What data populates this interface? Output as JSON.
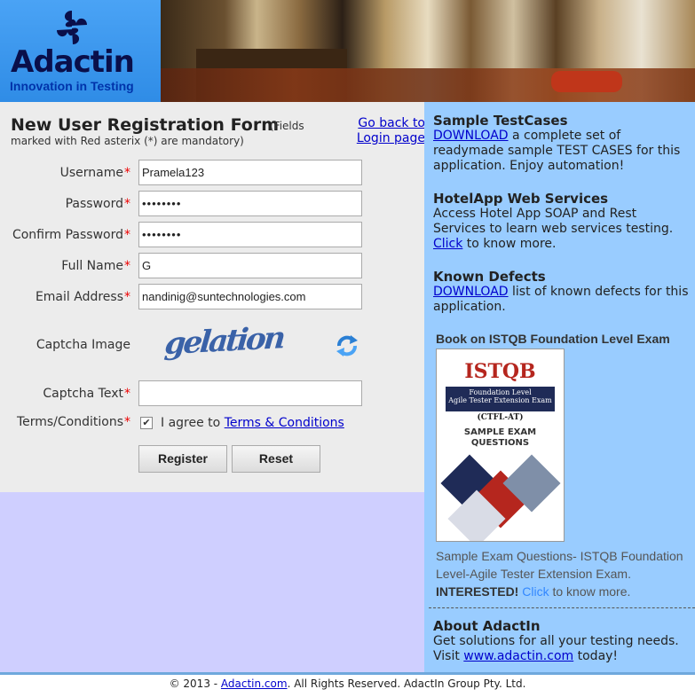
{
  "header": {
    "logo_text": "Adactin",
    "logo_tagline": "Innovation in Testing"
  },
  "form": {
    "title": "New User Registration Form",
    "note_part1": "(Fields",
    "note_part2": "marked with Red asterix (*) are mandatory)",
    "back_link_line1": "Go back to",
    "back_link_line2": "Login page",
    "required_marker": "*",
    "fields": {
      "username": {
        "label": "Username",
        "value": "Pramela123"
      },
      "password": {
        "label": "Password",
        "value": "••••••••"
      },
      "confirm_password": {
        "label": "Confirm Password",
        "value": "••••••••"
      },
      "full_name": {
        "label": "Full Name",
        "value": "G"
      },
      "email": {
        "label": "Email Address",
        "value": "nandinig@suntechnologies.com"
      },
      "captcha_image": {
        "label": "Captcha Image",
        "value": "gelation"
      },
      "captcha_text": {
        "label": "Captcha Text",
        "value": ""
      },
      "terms": {
        "label": "Terms/Conditions",
        "checked": true,
        "check_glyph": "✔",
        "agree_text": "I agree to",
        "link_text": "Terms & Conditions"
      }
    },
    "buttons": {
      "register": "Register",
      "reset": "Reset"
    }
  },
  "sidebar": {
    "sample_testcases": {
      "title": "Sample TestCases",
      "link": "DOWNLOAD",
      "text": " a complete set of readymade sample TEST CASES for this application. Enjoy automation!"
    },
    "web_services": {
      "title": "HotelApp Web Services",
      "text": "Access Hotel App SOAP and Rest Services to learn web services testing.",
      "link": "Click",
      "text_after": " to know more."
    },
    "known_defects": {
      "title": "Known Defects",
      "link": "DOWNLOAD",
      "text": " list of known defects for this application."
    },
    "book": {
      "title": "Book on ISTQB Foundation Level Exam",
      "cover_title": "ISTQB",
      "cover_band_line1": "Foundation Level",
      "cover_band_line2": "Agile Tester Extension Exam",
      "cover_code": "(CTFL-AT)",
      "cover_sample_line1": "SAMPLE EXAM",
      "cover_sample_line2": "QUESTIONS",
      "caption_line1": "Sample Exam Questions- ISTQB Foundation",
      "caption_line2": "Level-Agile Tester Extension Exam.",
      "caption_bold": "INTERESTED!",
      "caption_link": "Click",
      "caption_after": " to know more."
    },
    "about": {
      "title": "About AdactIn",
      "text1": "Get solutions for all your testing needs.",
      "text2_before": "Visit ",
      "link": "www.adactin.com",
      "text2_after": " today!"
    }
  },
  "footer": {
    "before": "© 2013 - ",
    "link": "Adactin.com",
    "after": ". All Rights Reserved. AdactIn Group Pty. Ltd."
  },
  "colors": {
    "logo_bg": "#2f8ce6",
    "form_bg": "#ececec",
    "sidebar_bg": "#99ccff",
    "lower_left_bg": "#cfcfff",
    "required": "#ee0000",
    "link": "#0000cc"
  }
}
